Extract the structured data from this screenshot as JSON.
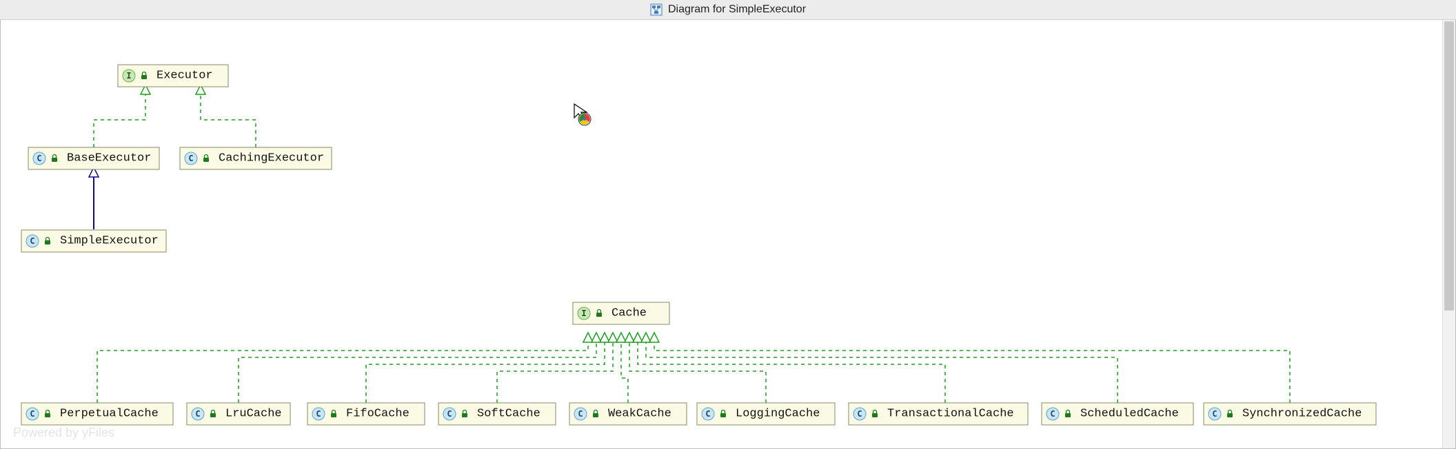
{
  "window": {
    "title": "Diagram for SimpleExecutor",
    "watermark": "Powered by yFiles"
  },
  "nodes": {
    "executor": {
      "kind": "interface",
      "label": "Executor"
    },
    "baseExecutor": {
      "kind": "class",
      "label": "BaseExecutor"
    },
    "cachingExecutor": {
      "kind": "class",
      "label": "CachingExecutor"
    },
    "simpleExecutor": {
      "kind": "class",
      "label": "SimpleExecutor"
    },
    "cache": {
      "kind": "interface",
      "label": "Cache"
    },
    "perpetualCache": {
      "kind": "class",
      "label": "PerpetualCache"
    },
    "lruCache": {
      "kind": "class",
      "label": "LruCache"
    },
    "fifoCache": {
      "kind": "class",
      "label": "FifoCache"
    },
    "softCache": {
      "kind": "class",
      "label": "SoftCache"
    },
    "weakCache": {
      "kind": "class",
      "label": "WeakCache"
    },
    "loggingCache": {
      "kind": "class",
      "label": "LoggingCache"
    },
    "transactionalCache": {
      "kind": "class",
      "label": "TransactionalCache"
    },
    "scheduledCache": {
      "kind": "class",
      "label": "ScheduledCache"
    },
    "synchronizedCache": {
      "kind": "class",
      "label": "SynchronizedCache"
    }
  },
  "edges": [
    {
      "from": "baseExecutor",
      "to": "executor",
      "type": "realize"
    },
    {
      "from": "cachingExecutor",
      "to": "executor",
      "type": "realize"
    },
    {
      "from": "simpleExecutor",
      "to": "baseExecutor",
      "type": "extend"
    },
    {
      "from": "perpetualCache",
      "to": "cache",
      "type": "realize"
    },
    {
      "from": "lruCache",
      "to": "cache",
      "type": "realize"
    },
    {
      "from": "fifoCache",
      "to": "cache",
      "type": "realize"
    },
    {
      "from": "softCache",
      "to": "cache",
      "type": "realize"
    },
    {
      "from": "weakCache",
      "to": "cache",
      "type": "realize"
    },
    {
      "from": "loggingCache",
      "to": "cache",
      "type": "realize"
    },
    {
      "from": "transactionalCache",
      "to": "cache",
      "type": "realize"
    },
    {
      "from": "scheduledCache",
      "to": "cache",
      "type": "realize"
    },
    {
      "from": "synchronizedCache",
      "to": "cache",
      "type": "realize"
    }
  ]
}
